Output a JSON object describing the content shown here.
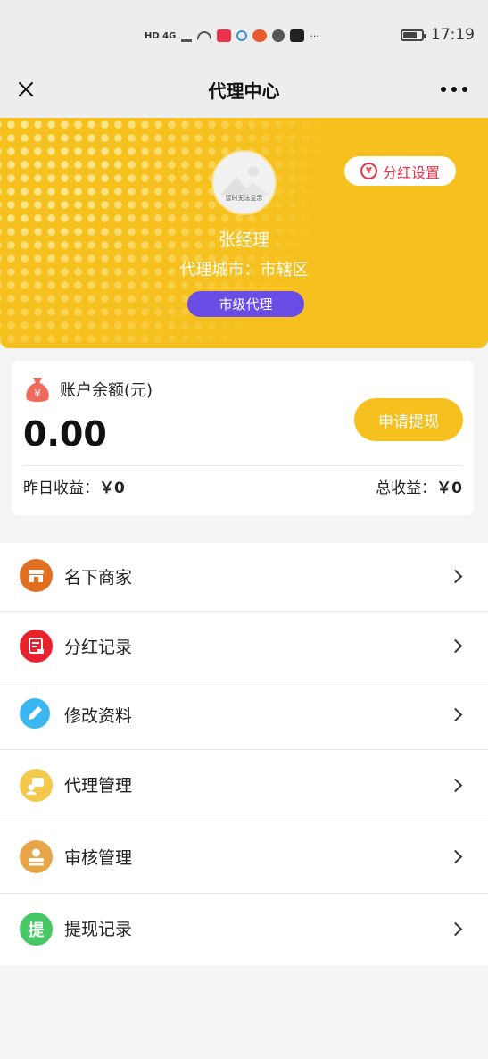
{
  "status_bar": {
    "indicators": "HD 4G",
    "more": "···",
    "time": "17:19",
    "battery_level": 0.75
  },
  "title_bar": {
    "title": "代理中心",
    "icons": [
      "close-icon",
      "more-icon"
    ]
  },
  "profile": {
    "bonus_settings_label": "分红设置",
    "avatar_caption": "暂时无法显示",
    "name": "张经理",
    "city_line": "代理城市：市辖区",
    "level": "市级代理"
  },
  "balance": {
    "label": "账户余额(元)",
    "value": "0.00",
    "withdraw_label": "申请提现",
    "yesterday_label": "昨日收益：",
    "yesterday_value": "￥0",
    "total_label": "总收益：",
    "total_value": "￥0"
  },
  "menu": {
    "items": [
      {
        "label": "名下商家",
        "icon": "store-icon",
        "color": "#e0701f"
      },
      {
        "label": "分红记录",
        "icon": "record-icon",
        "color": "#e8232e"
      },
      {
        "label": "修改资料",
        "icon": "edit-icon",
        "color": "#3bb6f0"
      },
      {
        "label": "代理管理",
        "icon": "agent-icon",
        "color": "#f4c84a"
      },
      {
        "label": "审核管理",
        "icon": "review-icon",
        "color": "#e8a548"
      },
      {
        "label": "提现记录",
        "icon": "withdraw-icon",
        "icon_text": "提",
        "color": "#47c766"
      }
    ]
  }
}
